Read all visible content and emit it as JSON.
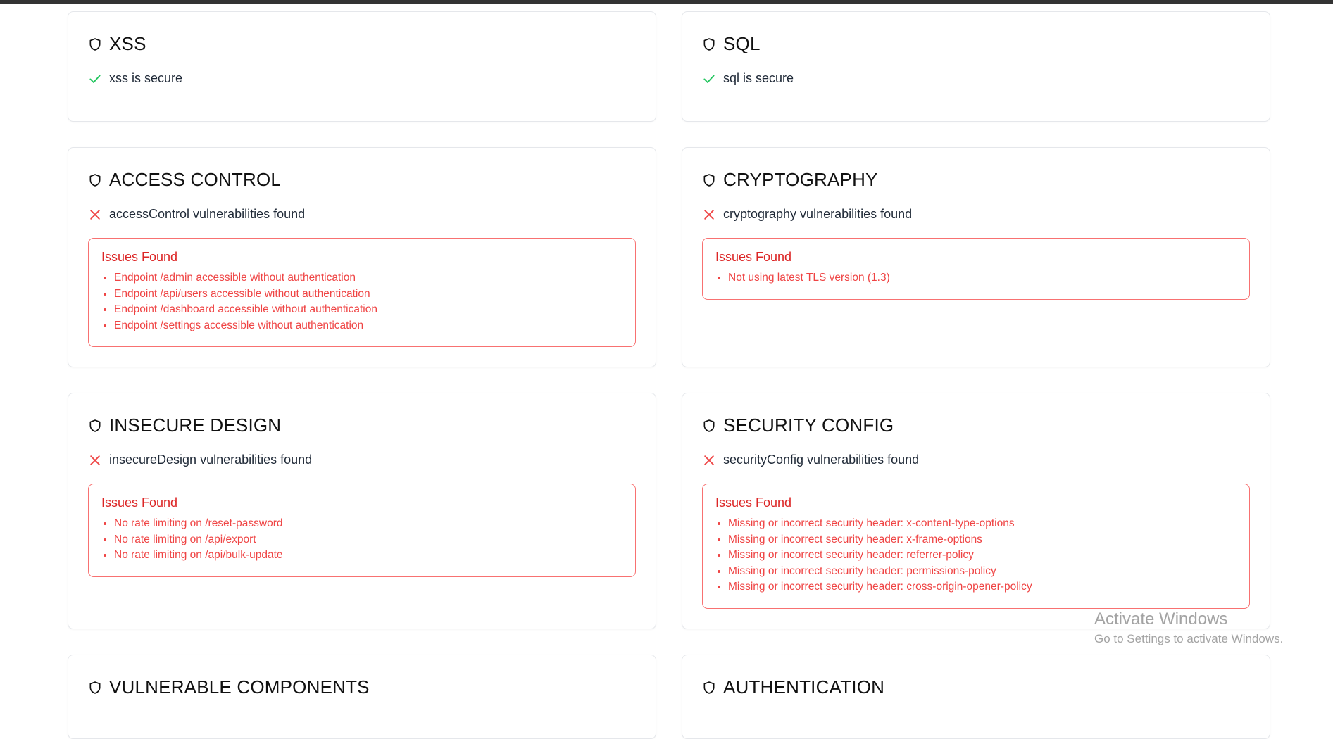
{
  "cards": [
    {
      "title": "XSS",
      "status": "xss is secure",
      "status_type": "secure",
      "issues_title": "",
      "issues": []
    },
    {
      "title": "SQL",
      "status": "sql is secure",
      "status_type": "secure",
      "issues_title": "",
      "issues": []
    },
    {
      "title": "ACCESS CONTROL",
      "status": "accessControl vulnerabilities found",
      "status_type": "vulnerable",
      "issues_title": "Issues Found",
      "issues": [
        "Endpoint /admin accessible without authentication",
        "Endpoint /api/users accessible without authentication",
        "Endpoint /dashboard accessible without authentication",
        "Endpoint /settings accessible without authentication"
      ]
    },
    {
      "title": "CRYPTOGRAPHY",
      "status": "cryptography vulnerabilities found",
      "status_type": "vulnerable",
      "issues_title": "Issues Found",
      "issues": [
        "Not using latest TLS version (1.3)"
      ]
    },
    {
      "title": "INSECURE DESIGN",
      "status": "insecureDesign vulnerabilities found",
      "status_type": "vulnerable",
      "issues_title": "Issues Found",
      "issues": [
        "No rate limiting on /reset-password",
        "No rate limiting on /api/export",
        "No rate limiting on /api/bulk-update"
      ]
    },
    {
      "title": "SECURITY CONFIG",
      "status": "securityConfig vulnerabilities found",
      "status_type": "vulnerable",
      "issues_title": "Issues Found",
      "issues": [
        "Missing or incorrect security header: x-content-type-options",
        "Missing or incorrect security header: x-frame-options",
        "Missing or incorrect security header: referrer-policy",
        "Missing or incorrect security header: permissions-policy",
        "Missing or incorrect security header: cross-origin-opener-policy"
      ]
    },
    {
      "title": "VULNERABLE COMPONENTS",
      "status": "",
      "status_type": "",
      "issues_title": "",
      "issues": []
    },
    {
      "title": "AUTHENTICATION",
      "status": "",
      "status_type": "",
      "issues_title": "",
      "issues": []
    }
  ],
  "colors": {
    "secure": "#22c55e",
    "vulnerable": "#ef4444",
    "issue_text": "#ef4444",
    "border": "#e5e7eb"
  },
  "icons": {
    "card": "shield-icon",
    "secure": "check-icon",
    "vulnerable": "x-icon"
  },
  "watermark": {
    "line1": "Activate Windows",
    "line2": "Go to Settings to activate Windows."
  }
}
